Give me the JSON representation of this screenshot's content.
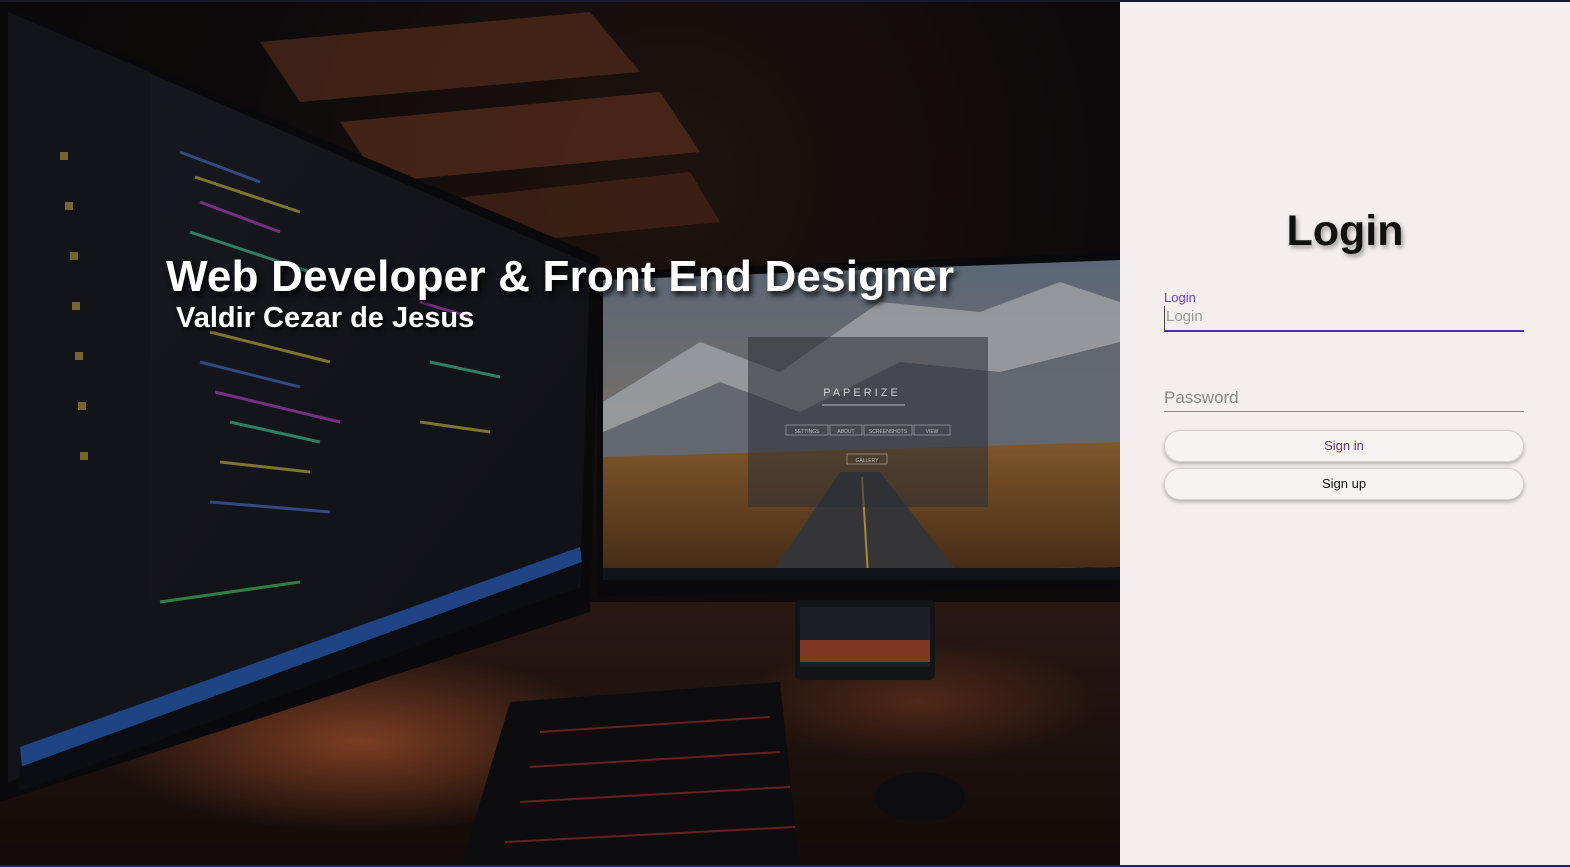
{
  "hero": {
    "title": "Web Developer & Front End Designer",
    "subtitle": "Valdir Cezar de Jesus",
    "monitor_app_title": "PAPERIZE",
    "monitor_buttons": [
      "SETTINGS",
      "ABOUT",
      "SCREENSHOTS",
      "VIEW"
    ],
    "monitor_gallery_label": "GALLERY"
  },
  "login_panel": {
    "title": "Login",
    "login_field": {
      "label": "Login",
      "placeholder": "Login",
      "value": ""
    },
    "password_field": {
      "placeholder": "Password",
      "value": ""
    },
    "signin_label": "Sign in",
    "signup_label": "Sign up"
  },
  "colors": {
    "panel_background": "#f4efee",
    "accent_purple": "#5b33b8",
    "input_underline": "#4b2fa8"
  }
}
